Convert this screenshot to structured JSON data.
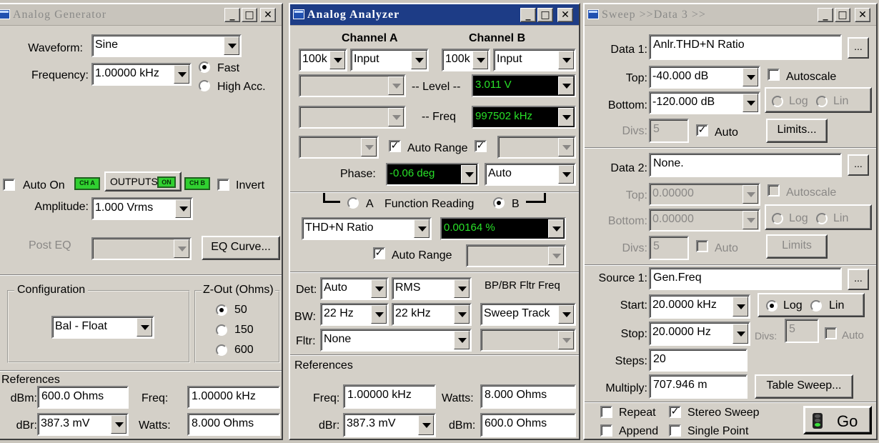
{
  "gen": {
    "title": "Analog Generator",
    "waveform_label": "Waveform:",
    "waveform": "Sine",
    "frequency_label": "Frequency:",
    "frequency": "1.00000 kHz",
    "fast": "Fast",
    "high_acc": "High Acc.",
    "auto_on": "Auto On",
    "led_ch_a": "CH A",
    "outputs": "OUTPUTS",
    "led_on": "ON",
    "led_ch_b": "CH B",
    "invert": "Invert",
    "amplitude_label": "Amplitude:",
    "amplitude": "1.000     Vrms",
    "post_eq_label": "Post EQ",
    "eq_curve": "EQ Curve...",
    "configuration_label": "Configuration",
    "configuration": "Bal - Float",
    "zout_label": "Z-Out (Ohms)",
    "zout_options": [
      "50",
      "150",
      "600"
    ],
    "references_label": "References",
    "dbm_label": "dBm:",
    "dbm": "600.0    Ohms",
    "freq_label": "Freq:",
    "freq": "1.00000 kHz",
    "dbr_label": "dBr:",
    "dbr": "387.3   mV",
    "watts_label": "Watts:",
    "watts": "8.000     Ohms"
  },
  "ana": {
    "title": "Analog Analyzer",
    "channel_a": "Channel A",
    "channel_b": "Channel B",
    "range_a": "100k",
    "input_a": "Input",
    "range_b": "100k",
    "input_b": "Input",
    "level_label": "-- Level --",
    "level_value": "3.011    V",
    "freq_label": "-- Freq",
    "freq_value": "997502 kHz",
    "auto_range": "Auto Range",
    "phase_label": "Phase:",
    "phase_value": "-0.06    deg",
    "phase_mode": "Auto",
    "radio_a": "A",
    "function_reading": "Function Reading",
    "radio_b": "B",
    "function": "THD+N Ratio",
    "function_value": "0.00164   %",
    "auto_range2": "Auto Range",
    "det_label": "Det:",
    "det": "Auto",
    "det_mode": "RMS",
    "bpbr_label": "BP/BR Fltr Freq",
    "bw_label": "BW:",
    "bw_low": "22 Hz",
    "bw_high": "22 kHz",
    "sweep_track": "Sweep Track",
    "fltr_label": "Fltr:",
    "fltr": "None",
    "references_label": "References",
    "freq_ref_label": "Freq:",
    "freq_ref": "1.00000 kHz",
    "watts_label": "Watts:",
    "watts": "8.000     Ohms",
    "dbr_label": "dBr:",
    "dbr": "387.3   mV",
    "dbm_label": "dBm:",
    "dbm": "600.0     Ohms"
  },
  "sweep": {
    "title": "Sweep >>Data 3 >>",
    "data1_label": "Data 1:",
    "data1": "Anlr.THD+N Ratio",
    "top_label": "Top:",
    "top": "-40.000  dB",
    "autoscale": "Autoscale",
    "bottom_label": "Bottom:",
    "bottom": "-120.000 dB",
    "log": "Log",
    "lin": "Lin",
    "divs_label": "Divs:",
    "divs": "5",
    "auto": "Auto",
    "limits": "Limits...",
    "data2_label": "Data 2:",
    "data2": "None.",
    "top2_label": "Top:",
    "top2": "0.00000",
    "autoscale2": "Autoscale",
    "bottom2_label": "Bottom:",
    "bottom2": "0.00000",
    "divs2_label": "Divs:",
    "divs2": "5",
    "auto2": "Auto",
    "limits2": "Limits",
    "source1_label": "Source 1:",
    "source1": "Gen.Freq",
    "start_label": "Start:",
    "start": "20.0000 kHz",
    "stop_label": "Stop:",
    "stop": "20.0000  Hz",
    "divs3_label": "Divs:",
    "divs3": "5",
    "auto3": "Auto",
    "steps_label": "Steps:",
    "steps": "20",
    "multiply_label": "Multiply:",
    "multiply": "707.946 m",
    "table_sweep": "Table Sweep...",
    "repeat": "Repeat",
    "stereo_sweep": "Stereo Sweep",
    "append": "Append",
    "single_point": "Single Point",
    "go": "Go",
    "ellipsis": "..."
  },
  "controls": {
    "minimize": "_",
    "maximize": "□",
    "close": "✕",
    "check": "✓"
  }
}
